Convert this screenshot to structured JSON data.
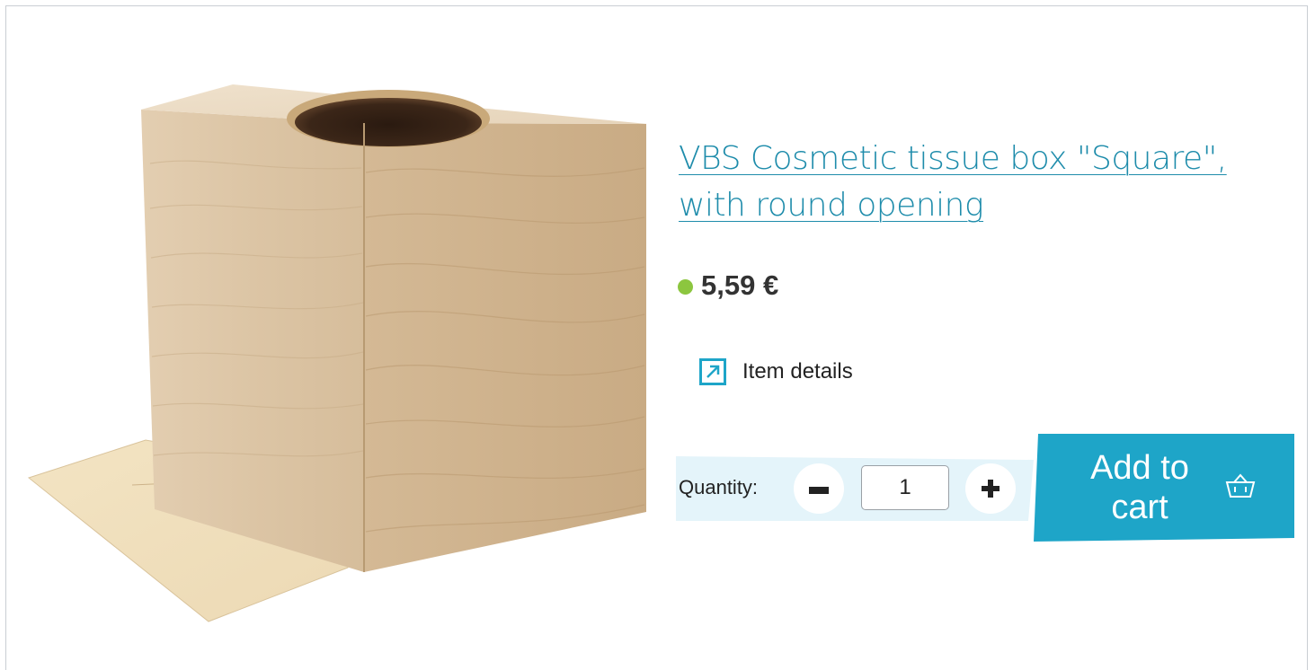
{
  "product": {
    "title": "VBS Cosmetic tissue box \"Square\", with round opening",
    "price": "5,59 €",
    "availability_color": "#8cc63f",
    "details_label": "Item details",
    "details_icon": "external-arrow-icon",
    "image_icon": "tissue-box-photo"
  },
  "purchase": {
    "quantity_label": "Quantity:",
    "quantity_value": "1",
    "minus_icon": "minus-icon",
    "plus_icon": "plus-icon",
    "add_to_cart_label": "Add to cart",
    "cart_icon": "basket-icon"
  },
  "colors": {
    "accent": "#1ea5c8",
    "link": "#1e8cab",
    "quantity_bar": "#e4f4fa"
  }
}
